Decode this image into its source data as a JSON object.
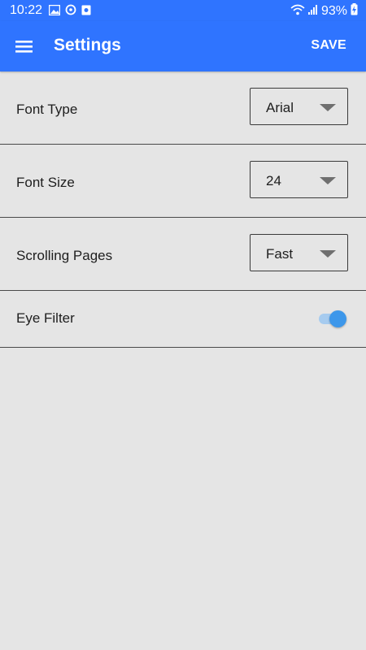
{
  "status_bar": {
    "time": "10:22",
    "battery": "93%",
    "icons": [
      "image-icon",
      "sync-icon",
      "app-icon",
      "wifi-icon",
      "signal-icon",
      "battery-charging-icon"
    ]
  },
  "app_bar": {
    "title": "Settings",
    "save_label": "SAVE",
    "menu_icon": "hamburger-menu-icon",
    "background_color": "#2f74ff"
  },
  "settings": {
    "font_type": {
      "label": "Font Type",
      "value": "Arial"
    },
    "font_size": {
      "label": "Font Size",
      "value": "24"
    },
    "scrolling_pages": {
      "label": "Scrolling Pages",
      "value": "Fast"
    },
    "eye_filter": {
      "label": "Eye Filter",
      "enabled": true,
      "accent_color": "#3d97ea"
    }
  }
}
